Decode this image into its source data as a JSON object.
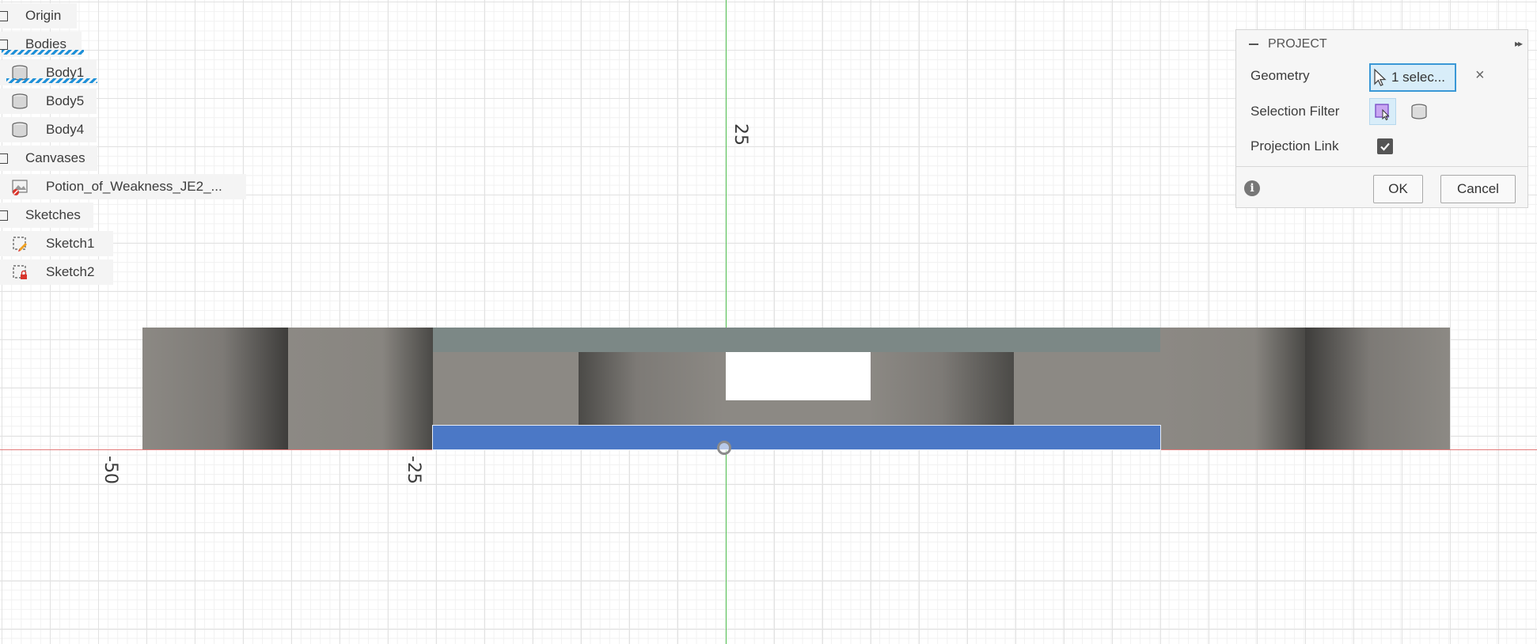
{
  "browser": {
    "items": [
      {
        "label": "Origin",
        "kind": "folder"
      },
      {
        "label": "Bodies",
        "kind": "folder"
      },
      {
        "label": "Body1",
        "kind": "body"
      },
      {
        "label": "Body5",
        "kind": "body"
      },
      {
        "label": "Body4",
        "kind": "body"
      },
      {
        "label": "Canvases",
        "kind": "folder"
      },
      {
        "label": "Potion_of_Weakness_JE2_...",
        "kind": "canvas"
      },
      {
        "label": "Sketches",
        "kind": "folder"
      },
      {
        "label": "Sketch1",
        "kind": "sketch"
      },
      {
        "label": "Sketch2",
        "kind": "sketch-locked"
      }
    ]
  },
  "viewport": {
    "axis_labels": {
      "y_25": "25",
      "x_neg50": "-50",
      "x_neg25": "-25"
    },
    "colors": {
      "x_axis": "#e37a7a",
      "y_axis": "#53c253",
      "selection": "#4b78c6"
    }
  },
  "dialog": {
    "title": "PROJECT",
    "geometry_label": "Geometry",
    "geometry_value": "1 selec...",
    "selection_filter_label": "Selection Filter",
    "projection_link_label": "Projection Link",
    "projection_link_checked": true,
    "ok_label": "OK",
    "cancel_label": "Cancel",
    "info_glyph": "i",
    "clear_glyph": "×",
    "expand_glyph": "▸▸"
  }
}
